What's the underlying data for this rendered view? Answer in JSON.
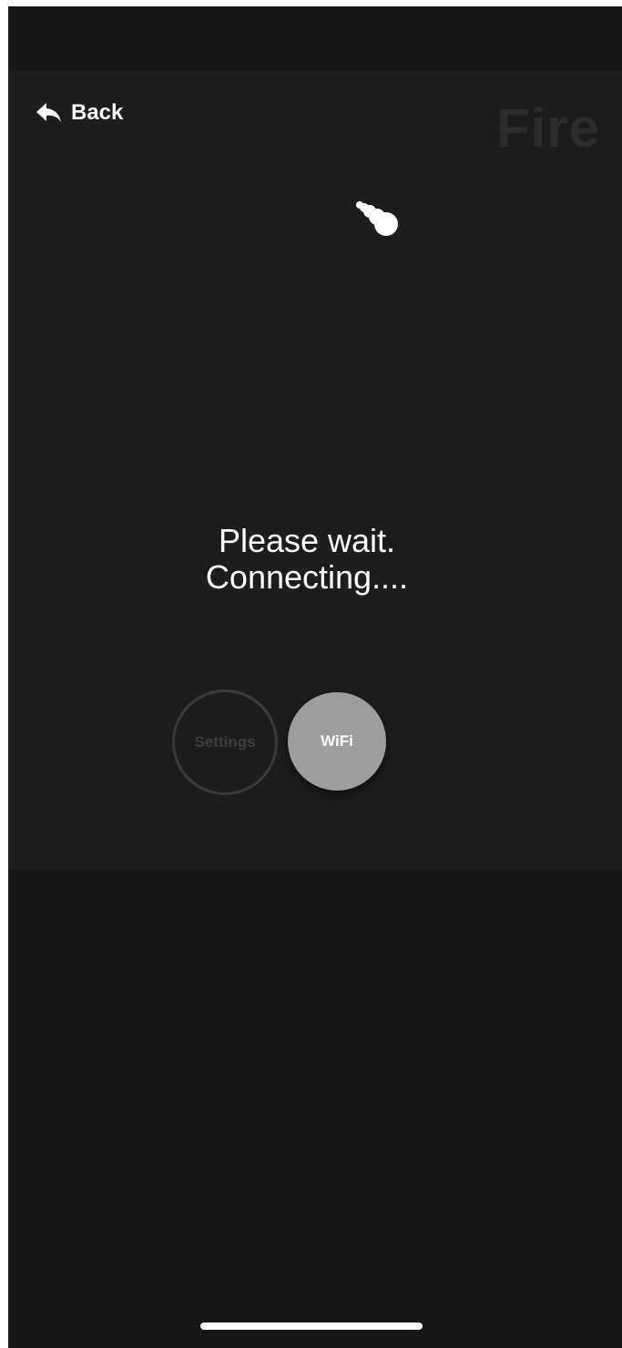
{
  "header": {
    "back_label": "Back",
    "mode_title": "Fire"
  },
  "status": {
    "line1": "Please wait.",
    "line2": "Connecting...."
  },
  "buttons": {
    "settings_label": "Settings",
    "wifi_label": "WiFi"
  },
  "icons": {
    "back": "back-arrow-icon",
    "loading": "loading-spinner-icon"
  },
  "colors": {
    "background": "#161616",
    "panel": "#1d1d1d",
    "text": "#ffffff",
    "title_dim": "#2c2c2c",
    "wifi_active": "#9d9d9d",
    "settings_outline": "#3a3a3a"
  }
}
